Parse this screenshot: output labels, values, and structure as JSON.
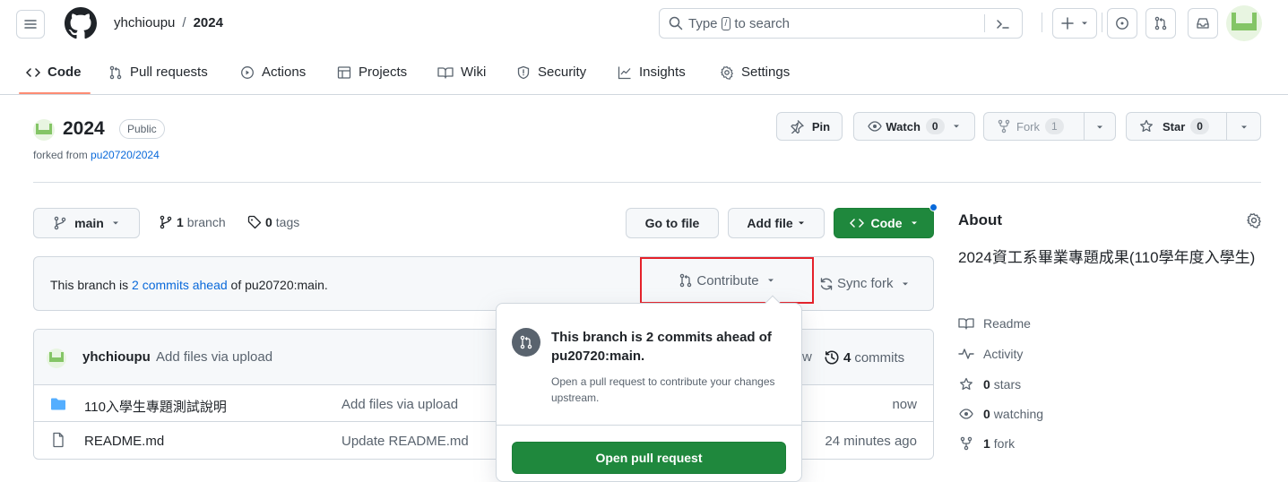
{
  "header": {
    "owner": "yhchioupu",
    "separator": "/",
    "repo": "2024",
    "search_placeholder_pre": "Type",
    "search_key": "/",
    "search_placeholder_post": "to search"
  },
  "nav": {
    "tabs": [
      {
        "label": "Code"
      },
      {
        "label": "Pull requests"
      },
      {
        "label": "Actions"
      },
      {
        "label": "Projects"
      },
      {
        "label": "Wiki"
      },
      {
        "label": "Security"
      },
      {
        "label": "Insights"
      },
      {
        "label": "Settings"
      }
    ]
  },
  "repo": {
    "name": "2024",
    "visibility": "Public",
    "forked_prefix": "forked from",
    "forked_from": "pu20720/2024",
    "pin_label": "Pin",
    "watch_label": "Watch",
    "watch_count": "0",
    "fork_label": "Fork",
    "fork_count": "1",
    "star_label": "Star",
    "star_count": "0"
  },
  "toolbar": {
    "branch": "main",
    "branches_count": "1",
    "branches_label": "branch",
    "tags_count": "0",
    "tags_label": "tags",
    "go_to_file": "Go to file",
    "add_file": "Add file",
    "code": "Code"
  },
  "banner": {
    "prefix": "This branch is",
    "link": "2 commits ahead",
    "suffix": "of pu20720:main.",
    "contribute": "Contribute",
    "sync_fork": "Sync fork"
  },
  "commit": {
    "author": "yhchioupu",
    "message": "Add files via upload",
    "time_partial": "w",
    "commits_count": "4",
    "commits_label": "commits"
  },
  "files": [
    {
      "name": "110入學生專題測試說明",
      "message": "Add files via upload",
      "time": "now",
      "type": "folder"
    },
    {
      "name": "README.md",
      "message": "Update README.md",
      "time": "24 minutes ago",
      "type": "file"
    }
  ],
  "popover": {
    "title": "This branch is 2 commits ahead of pu20720:main.",
    "description": "Open a pull request to contribute your changes upstream.",
    "button": "Open pull request"
  },
  "about": {
    "heading": "About",
    "description": "2024資工系畢業專題成果(110學年度入學生)",
    "readme": "Readme",
    "activity": "Activity",
    "stars_count": "0",
    "stars_label": "stars",
    "watching_count": "0",
    "watching_label": "watching",
    "forks_count": "1",
    "forks_label": "fork"
  },
  "colors": {
    "primary_green": "#1f883d",
    "link_blue": "#0969da",
    "highlight_red": "#e5212a",
    "border": "#d0d7de",
    "tab_underline": "#fd8c73",
    "folder_blue": "#54aeff"
  }
}
